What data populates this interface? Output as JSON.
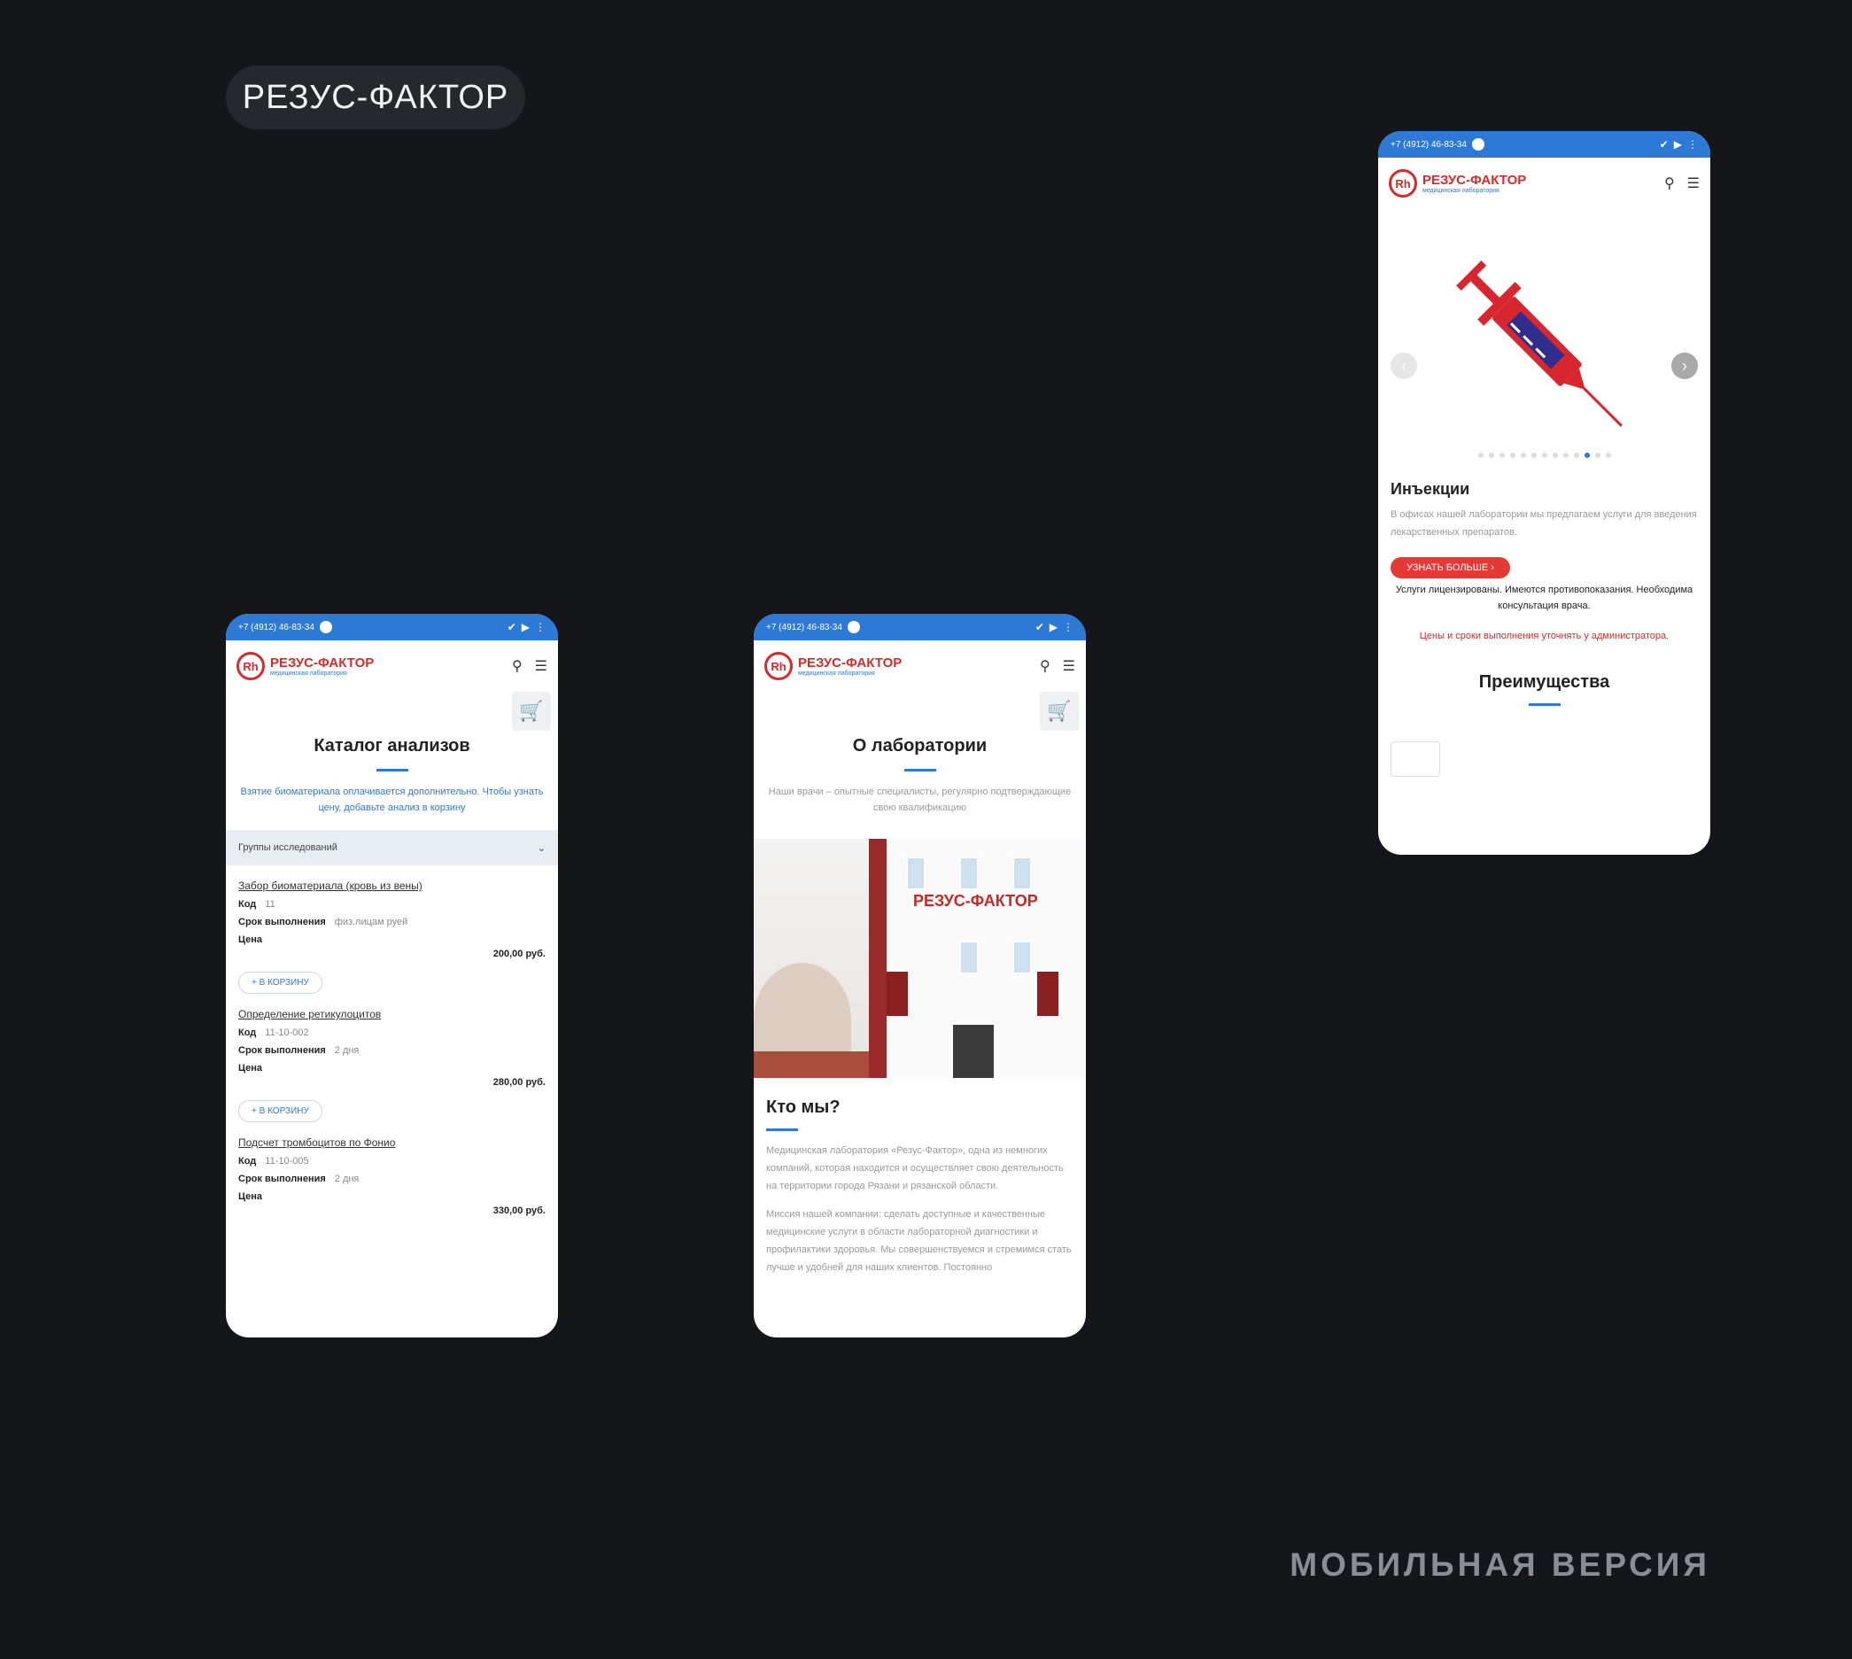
{
  "brand_label": "РЕЗУС-ФАКТОР",
  "footer_caption": "МОБИЛЬНАЯ ВЕРСИЯ",
  "colors": {
    "background": "#14161a",
    "accent_blue": "#2d7ad6",
    "brand_red": "#d72b2b"
  },
  "common": {
    "status_phone": "+7 (4912) 46-83-34",
    "logo_mark": "Rh",
    "logo_name": "РЕЗУС-ФАКТОР",
    "logo_sub": "медицинская лаборатория",
    "icons": [
      "search-icon",
      "menu-icon",
      "cart-icon"
    ]
  },
  "catalog": {
    "title": "Каталог анализов",
    "note": "Взятие биоматериала оплачивается дополнительно. Чтобы узнать цену, добавьте анализ в корзину",
    "group_select": "Группы исследований",
    "labels": {
      "code": "Код",
      "term": "Срок выполнения",
      "price": "Цена",
      "add": "В КОРЗИНУ"
    },
    "items": [
      {
        "title": "Забор биоматериала (кровь из вены)",
        "code": "11",
        "term": "физ.лицам руей",
        "price": "200,00 руб."
      },
      {
        "title": "Определение ретикулоцитов",
        "code": "11-10-002",
        "term": "2 дня",
        "price": "280,00 руб."
      },
      {
        "title": "Подсчет тромбоцитов по Фонио",
        "code": "11-10-005",
        "term": "2 дня",
        "price": "330,00 руб."
      }
    ]
  },
  "about": {
    "title": "О лаборатории",
    "subtitle": "Наши врачи – опытные специалисты, регулярно подтверждающие свою квалификацию",
    "building_sign": "РЕЗУС-ФАКТОР",
    "who_title": "Кто мы?",
    "paragraphs": [
      "Медицинская лаборатория «Резус-Фактор», одна из немногих компаний, которая находится и осуществляет свою деятельность на территории города Рязани и рязанской области.",
      "Миссия нашей компании: сделать доступные и качественные медицинские услуги в области лабораторной диагностики и профилактики здоровья. Мы совершенствуемся и стремимся стать лучше и удобней для наших клиентов. Постоянно"
    ]
  },
  "inject": {
    "service_title": "Инъекции",
    "service_desc": "В офисах нашей лаборатории мы предлагаем услуги для введения лекарственных препаратов.",
    "more_button": "УЗНАТЬ БОЛЬШЕ",
    "warning": "Услуги лицензированы. Имеются противопоказания. Необходима консультация врача.",
    "price_note": "Цены и сроки выполнения уточнять у администратора.",
    "advantages_title": "Преимущества",
    "slide_count": 13,
    "active_slide": 10
  }
}
